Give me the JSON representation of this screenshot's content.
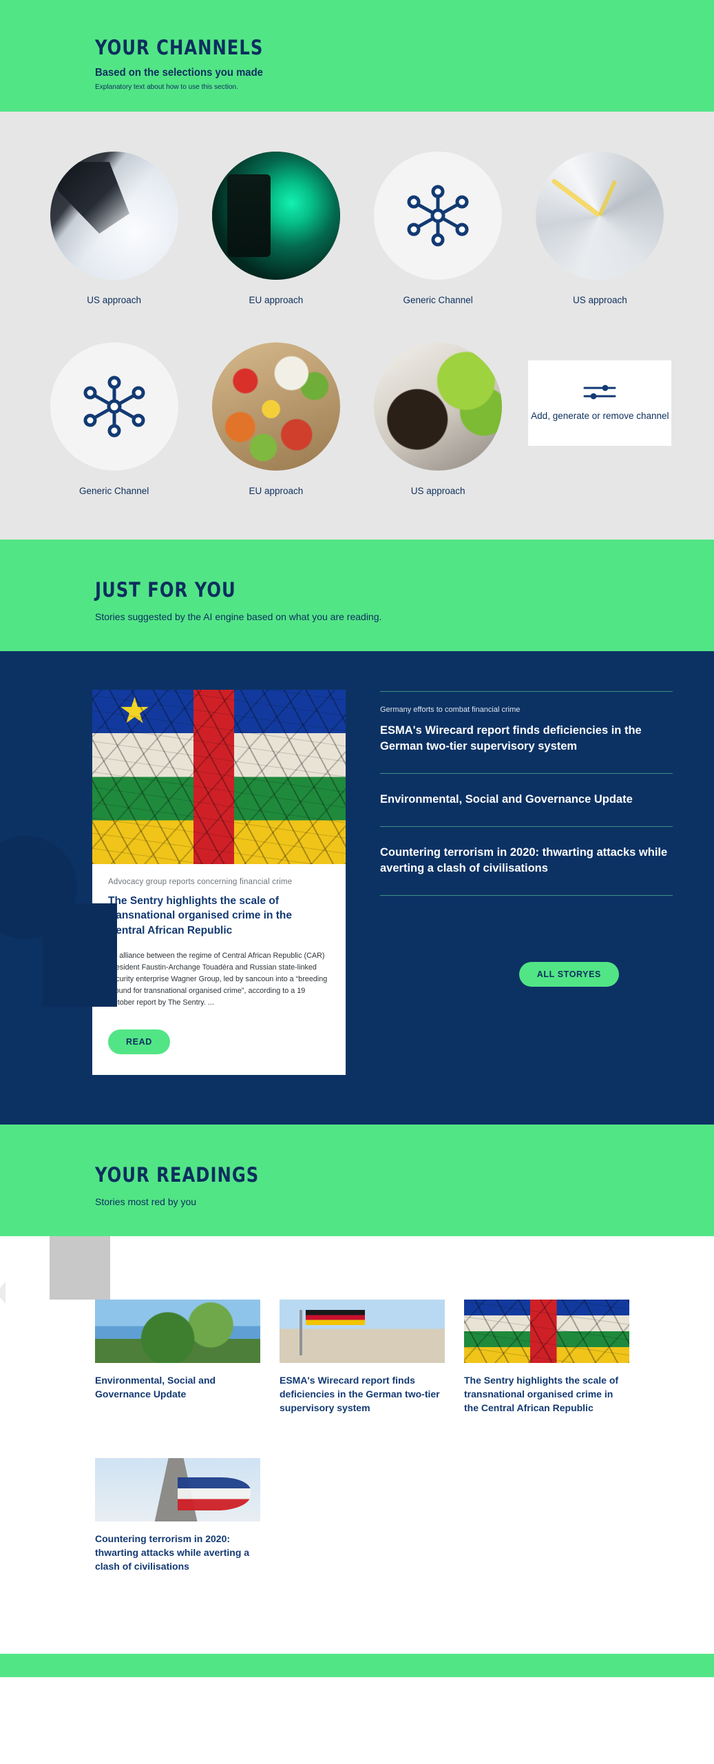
{
  "theme": {
    "green": "#52e586",
    "navy": "#0d2f5e",
    "dark_blue": "#0c3264",
    "grey_band": "#e6e6e6",
    "card_title_blue": "#133a73"
  },
  "channels_section": {
    "title": "YOUR CHANNELS",
    "subtitle": "Based on the selections you made",
    "explanatory": "Explanatory text about how to use this section.",
    "items": [
      {
        "label": "US approach",
        "icon": "photo-pen-on-paper",
        "kind": "photo"
      },
      {
        "label": "EU approach",
        "icon": "photo-traffic-light",
        "kind": "photo"
      },
      {
        "label": "Generic Channel",
        "icon": "hub-network-icon",
        "kind": "icon"
      },
      {
        "label": "US approach",
        "icon": "photo-clock-face",
        "kind": "photo"
      },
      {
        "label": "Generic Channel",
        "icon": "hub-network-icon",
        "kind": "icon"
      },
      {
        "label": "EU approach",
        "icon": "photo-fresh-food",
        "kind": "photo"
      },
      {
        "label": "US approach",
        "icon": "photo-coffee-and-salad",
        "kind": "photo"
      }
    ],
    "add_card": {
      "icon": "sliders-icon",
      "label": "Add, generate or remove channel"
    }
  },
  "just_for_you": {
    "title": "JUST FOR YOU",
    "subtitle": "Stories suggested by the AI engine based on what you are reading.",
    "featured": {
      "image": "photo-central-african-republic-flag-cracked-earth",
      "kicker": "Advocacy group reports concerning financial crime",
      "title": "The Sentry highlights the scale of transnational organised crime in the Central African Republic",
      "body": "An alliance between the regime of Central African Republic (CAR) President Faustin-Archange Touadéra and Russian state-linked security enterprise Wagner Group, led by sancoun into a “breeding ground for transnational organised crime”, according to a 19 October report by The Sentry. ...",
      "button": "READ"
    },
    "stories": [
      {
        "kicker": "Germany efforts to combat financial crime",
        "title": "ESMA's Wirecard report finds deficiencies in the German two-tier supervisory system"
      },
      {
        "kicker": "",
        "title": "Environmental, Social and Governance Update"
      },
      {
        "kicker": "",
        "title": "Countering terrorism in 2020: thwarting attacks while averting a clash of civilisations"
      }
    ],
    "all_button": "ALL STORYES"
  },
  "your_readings": {
    "title": "YOUR READINGS",
    "subtitle": "Stories most red by you",
    "cards": [
      {
        "title": "Environmental, Social and Governance Update",
        "image": "photo-earth-from-space"
      },
      {
        "title": "ESMA's Wirecard report finds deficiencies in the German two-tier supervisory system",
        "image": "photo-german-flag-reichstag"
      },
      {
        "title": "The Sentry highlights the scale of transnational organised crime in the Central African Republic",
        "image": "photo-central-african-republic-flag-cracked-earth"
      },
      {
        "title": "Countering terrorism in 2020: thwarting attacks while averting a clash of civilisations",
        "image": "photo-french-flag-arc-de-triomphe"
      }
    ]
  }
}
